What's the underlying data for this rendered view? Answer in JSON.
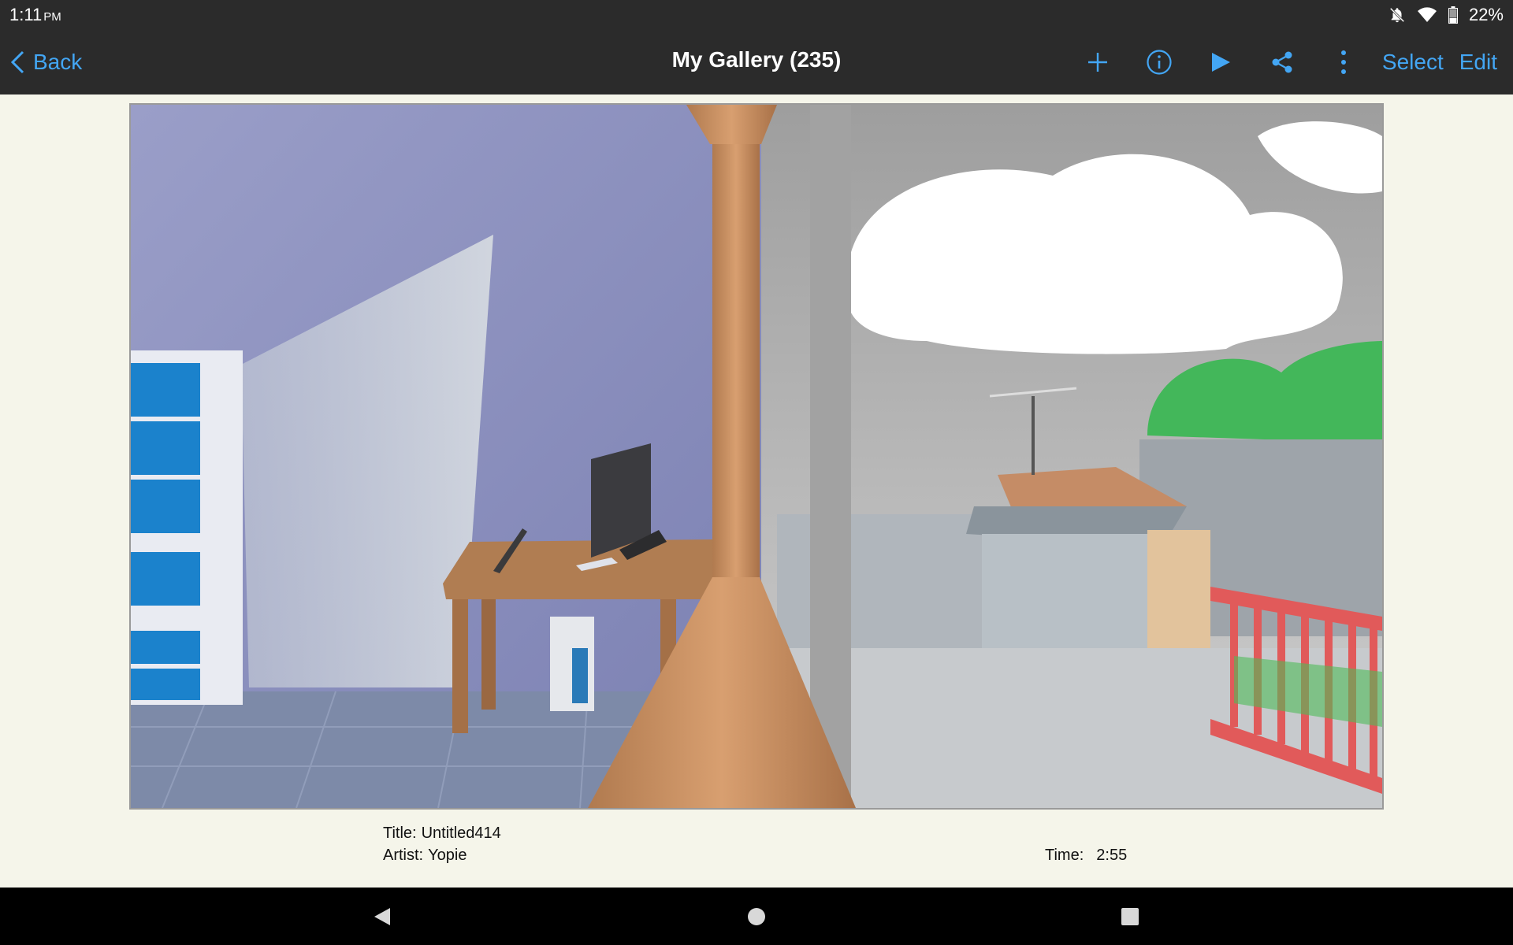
{
  "status_bar": {
    "time": "1:11",
    "time_suffix": "PM",
    "battery": "22%",
    "icons": [
      "notifications-off-icon",
      "wifi-icon",
      "battery-icon"
    ]
  },
  "toolbar": {
    "back_label": "Back",
    "title": "My Gallery (235)",
    "select_label": "Select",
    "edit_label": "Edit",
    "icons": [
      "add-icon",
      "info-icon",
      "play-icon",
      "share-icon",
      "more-vertical-icon"
    ]
  },
  "artwork_info": {
    "title_label": "Title:",
    "title_value": "Untitled414",
    "artist_label": "Artist:",
    "artist_value": "Yopie",
    "time_label": "Time:",
    "time_value": "2:55"
  },
  "nav_bar": {
    "icons": [
      "back-triangle-icon",
      "home-circle-icon",
      "recents-square-icon"
    ]
  },
  "colors": {
    "accent": "#43a6f4",
    "toolbar_bg": "#2b2b2b",
    "page_bg": "#f5f5ea",
    "nav_bg": "#000000"
  }
}
